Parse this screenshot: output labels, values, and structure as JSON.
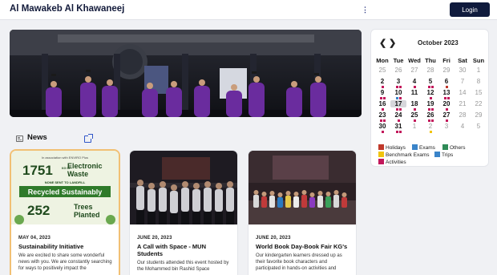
{
  "header": {
    "brand": "Al Mawakeb Al Khawaneej",
    "menu_glyph": "⋮",
    "login_label": "Login"
  },
  "hero": {
    "image_alt": "Graduation ceremony stage with students in purple gowns"
  },
  "news": {
    "section_title": "News",
    "items": [
      {
        "date": "MAY 04, 2023",
        "title": "Sustainability Initiative",
        "excerpt": "We are excited to share some wonderful news with you. We are constantly searching for ways to positively impact the",
        "image_text": {
          "top_note": "In association with ENVIRO Plus",
          "big_number_1": "1751",
          "unit_1": "KG OF",
          "label_1a": "Electronic",
          "label_1b": "Waste",
          "subline": "NONE SENT TO LANDFILL",
          "banner": "Recycled Sustainably",
          "big_number_2": "252",
          "label_2a": "Trees",
          "label_2b": "Planted"
        }
      },
      {
        "date": "JUNE 20, 2023",
        "title": "A Call with Space - MUN Students",
        "excerpt": "Our students attended this event hosted by the Mohammed bin Rashid Space"
      },
      {
        "date": "JUNE 20, 2023",
        "title": "World Book Day-Book Fair KG's",
        "excerpt": "Our kindergarten learners dressed up as their favorite book characters and participated in hands-on activities and"
      }
    ]
  },
  "calendar": {
    "prev": "❮",
    "next": "❯",
    "month": "October 2023",
    "weekdays": [
      "Mon",
      "Tue",
      "Wed",
      "Thu",
      "Fri",
      "Sat",
      "Sun"
    ],
    "weeks": [
      [
        "25",
        "26",
        "27",
        "28",
        "29",
        "30",
        "1"
      ],
      [
        "2",
        "3",
        "4",
        "5",
        "6",
        "7",
        "8"
      ],
      [
        "9",
        "10",
        "11",
        "12",
        "13",
        "14",
        "15"
      ],
      [
        "16",
        "17",
        "18",
        "19",
        "20",
        "21",
        "22"
      ],
      [
        "23",
        "24",
        "25",
        "26",
        "27",
        "28",
        "29"
      ],
      [
        "30",
        "31",
        "1",
        "2",
        "3",
        "4",
        "5"
      ]
    ],
    "legend": [
      {
        "label": "Holidays",
        "color": "#c0392b"
      },
      {
        "label": "Exams",
        "color": "#3a84c9"
      },
      {
        "label": "Others",
        "color": "#2e8b57"
      },
      {
        "label": "Benchmark Exams",
        "color": "#f1c40f"
      },
      {
        "label": "Trips",
        "color": "#3a84c9"
      },
      {
        "label": "Activities",
        "color": "#c2185b"
      }
    ]
  }
}
